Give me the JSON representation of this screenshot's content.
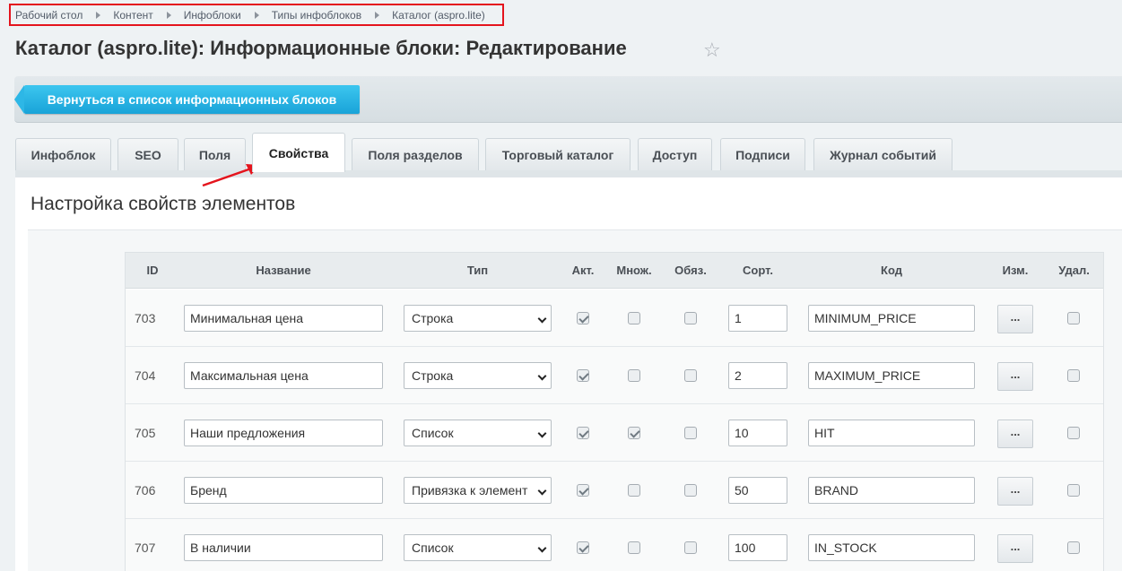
{
  "breadcrumb": [
    "Рабочий стол",
    "Контент",
    "Инфоблоки",
    "Типы инфоблоков",
    "Каталог (aspro.lite)"
  ],
  "page_title": "Каталог (aspro.lite): Информационные блоки: Редактирование",
  "toolbar": {
    "back_label": "Вернуться в список информационных блоков"
  },
  "tabs": [
    "Инфоблок",
    "SEO",
    "Поля",
    "Свойства",
    "Поля разделов",
    "Торговый каталог",
    "Доступ",
    "Подписи",
    "Журнал событий"
  ],
  "active_tab": "Свойства",
  "section_title": "Настройка свойств элементов",
  "table": {
    "headers": [
      "ID",
      "Название",
      "Тип",
      "Акт.",
      "Множ.",
      "Обяз.",
      "Сорт.",
      "Код",
      "Изм.",
      "Удал."
    ],
    "edit_label": "...",
    "rows": [
      {
        "id": "703",
        "name": "Минимальная цена",
        "type": "Строка",
        "active": true,
        "multiple": false,
        "required": false,
        "sort": "1",
        "code": "MINIMUM_PRICE",
        "delete": false
      },
      {
        "id": "704",
        "name": "Максимальная цена",
        "type": "Строка",
        "active": true,
        "multiple": false,
        "required": false,
        "sort": "2",
        "code": "MAXIMUM_PRICE",
        "delete": false
      },
      {
        "id": "705",
        "name": "Наши предложения",
        "type": "Список",
        "active": true,
        "multiple": true,
        "required": false,
        "sort": "10",
        "code": "HIT",
        "delete": false
      },
      {
        "id": "706",
        "name": "Бренд",
        "type": "Привязка к элемент",
        "active": true,
        "multiple": false,
        "required": false,
        "sort": "50",
        "code": "BRAND",
        "delete": false
      },
      {
        "id": "707",
        "name": "В наличии",
        "type": "Список",
        "active": true,
        "multiple": false,
        "required": false,
        "sort": "100",
        "code": "IN_STOCK",
        "delete": false
      }
    ]
  },
  "colors": {
    "accent": "#19a3d8",
    "annotation": "#e4141d"
  }
}
